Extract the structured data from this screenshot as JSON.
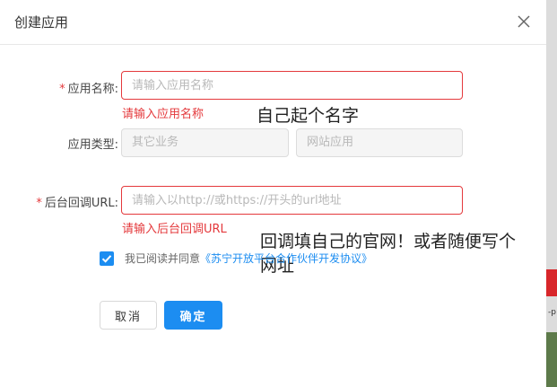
{
  "dialog": {
    "title": "创建应用",
    "close_icon": "close-icon"
  },
  "form": {
    "app_name": {
      "required_mark": "*",
      "label": "应用名称:",
      "placeholder": "请输入应用名称",
      "value": "",
      "error": "请输入应用名称"
    },
    "app_type": {
      "label": "应用类型:",
      "options": [
        "其它业务",
        "网站应用"
      ]
    },
    "callback_url": {
      "required_mark": "*",
      "label": "后台回调URL:",
      "placeholder": "请输入以http://或https://开头的url地址",
      "value": "",
      "error": "请输入后台回调URL"
    },
    "agreement": {
      "checked": true,
      "text": "我已阅读并同意",
      "link": "《苏宁开放平台合作伙伴开发协议》"
    }
  },
  "annotations": {
    "name_note": "自己起个名字",
    "url_note_line1": "回调填自己的官网！或者随便写个",
    "url_note_line2": "网址"
  },
  "buttons": {
    "cancel": "取消",
    "ok": "确定"
  },
  "background": {
    "text": "-p"
  },
  "colors": {
    "primary": "#1c8df1",
    "error": "#e4393c"
  }
}
